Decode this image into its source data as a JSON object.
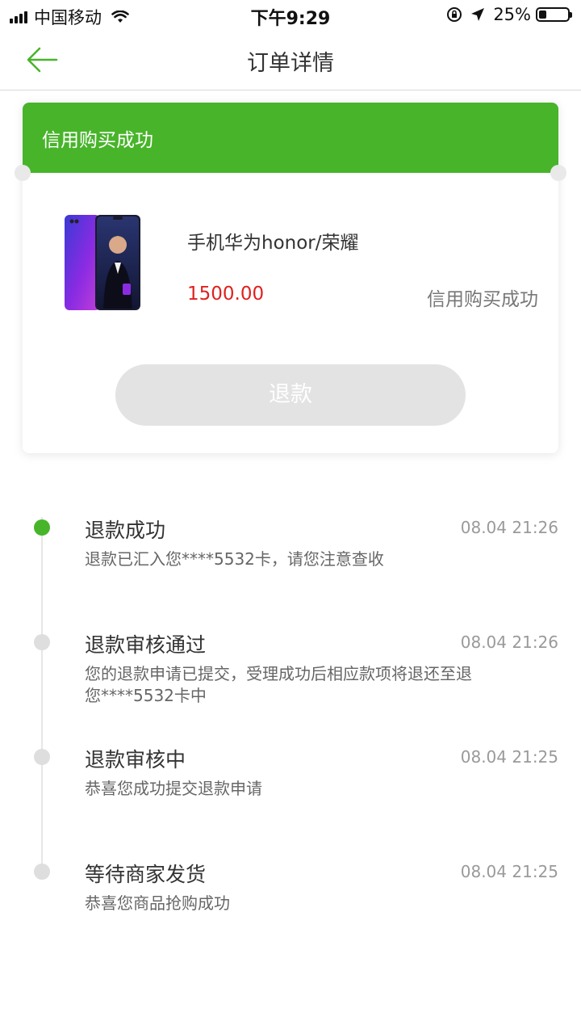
{
  "status_bar": {
    "carrier": "中国移动",
    "time": "下午9:29",
    "battery": "25%",
    "battery_level": 0.25
  },
  "nav": {
    "back_icon": "arrow-left-icon",
    "title": "订单详情"
  },
  "order": {
    "header": "信用购买成功",
    "product_name": "手机华为honor/荣耀",
    "price": "1500.00",
    "status": "信用购买成功",
    "refund_button": "退款"
  },
  "colors": {
    "accent_green": "#48b42a",
    "price_red": "#e02020",
    "inactive_gray": "#dedede"
  },
  "timeline": [
    {
      "title": "退款成功",
      "time": "08.04 21:26",
      "desc": "退款已汇入您****5532卡，请您注意查收",
      "active": true
    },
    {
      "title": "退款审核通过",
      "time": "08.04 21:26",
      "desc": "您的退款申请已提交，受理成功后相应款项将退还至退您****5532卡中",
      "active": false
    },
    {
      "title": "退款审核中",
      "time": "08.04 21:25",
      "desc": "恭喜您成功提交退款申请",
      "active": false
    },
    {
      "title": "等待商家发货",
      "time": "08.04 21:25",
      "desc": "恭喜您商品抢购成功",
      "active": false
    }
  ]
}
